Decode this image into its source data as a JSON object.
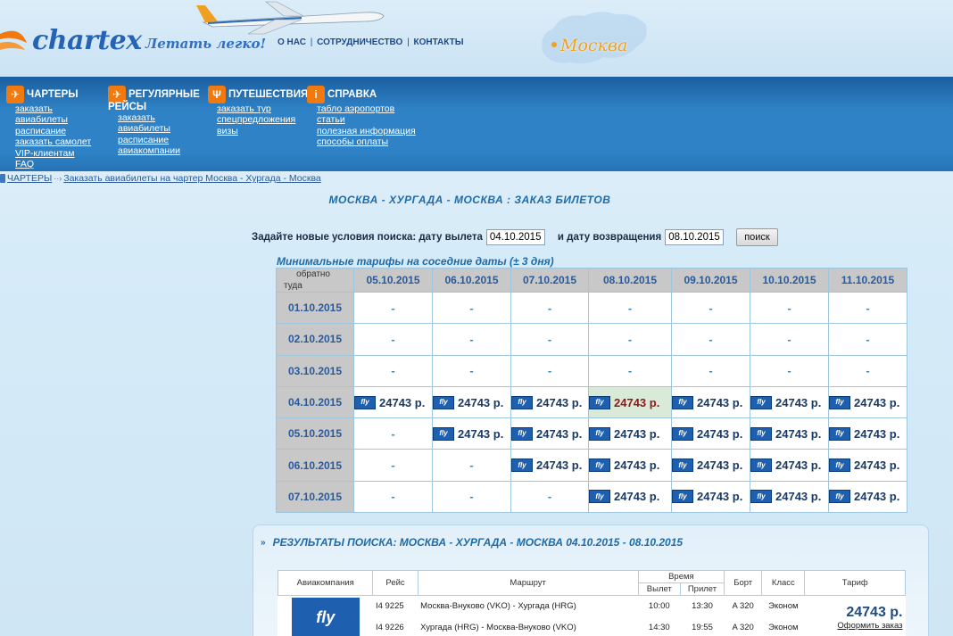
{
  "header": {
    "logo_text": "chartex",
    "slogan": "Летать легко!",
    "top_links": [
      "О НАС",
      "СОТРУДНИЧЕСТВО",
      "КОНТАКТЫ"
    ],
    "city": "Москва"
  },
  "menu": [
    {
      "title": "ЧАРТЕРЫ",
      "icon": "plane-icon",
      "items": [
        "заказать",
        "авиабилеты",
        "расписание",
        "заказать самолет",
        "VIP-клиентам",
        "FAQ"
      ]
    },
    {
      "title": "РЕГУЛЯРНЫЕ",
      "subtitle": "РЕЙСЫ",
      "icon": "plane-icon",
      "items": [
        "заказать",
        "авиабилеты",
        "расписание",
        "авиакомпании"
      ]
    },
    {
      "title": "ПУТЕШЕСТВИЯ",
      "icon": "palm-icon",
      "items": [
        "заказать тур",
        "спецпредложения",
        "визы"
      ]
    },
    {
      "title": "СПРАВКА",
      "icon": "info-icon",
      "items": [
        "табло аэропортов",
        "статьи",
        "полезная информация",
        "способы оплаты"
      ]
    }
  ],
  "breadcrumb": {
    "root": "ЧАРТЕРЫ",
    "current": "Заказать авиабилеты на чартер Москва - Хургада - Москва"
  },
  "page_title": "МОСКВА - ХУРГАДА - МОСКВА : ЗАКАЗ БИЛЕТОВ",
  "search": {
    "label_departure": "Задайте новые условия поиска: дату вылета",
    "departure_value": "04.10.2015",
    "label_return": "и дату возвращения",
    "return_value": "08.10.2015",
    "button": "поиск"
  },
  "matrix": {
    "caption": "Минимальные тарифы на соседние даты (± 3 дня)",
    "corner_back": "обратно",
    "corner_there": "туда",
    "return_dates": [
      "05.10.2015",
      "06.10.2015",
      "07.10.2015",
      "08.10.2015",
      "09.10.2015",
      "10.10.2015",
      "11.10.2015"
    ],
    "departure_dates": [
      "01.10.2015",
      "02.10.2015",
      "03.10.2015",
      "04.10.2015",
      "05.10.2015",
      "06.10.2015",
      "07.10.2015"
    ],
    "cells": [
      [
        "-",
        "-",
        "-",
        "-",
        "-",
        "-",
        "-"
      ],
      [
        "-",
        "-",
        "-",
        "-",
        "-",
        "-",
        "-"
      ],
      [
        "-",
        "-",
        "-",
        "-",
        "-",
        "-",
        "-"
      ],
      [
        "24743 р.",
        "24743 р.",
        "24743 р.",
        "24743 р.",
        "24743 р.",
        "24743 р.",
        "24743 р."
      ],
      [
        "-",
        "24743 р.",
        "24743 р.",
        "24743 р.",
        "24743 р.",
        "24743 р.",
        "24743 р."
      ],
      [
        "-",
        "-",
        "24743 р.",
        "24743 р.",
        "24743 р.",
        "24743 р.",
        "24743 р."
      ],
      [
        "-",
        "-",
        "-",
        "24743 р.",
        "24743 р.",
        "24743 р.",
        "24743 р."
      ]
    ],
    "selected": {
      "row": 3,
      "col": 3
    },
    "airline_badge": "fly"
  },
  "results": {
    "title": "РЕЗУЛЬТАТЫ ПОИСКА: МОСКВА - ХУРГАДА - МОСКВА 04.10.2015 - 08.10.2015",
    "headers": {
      "airline": "Авиакомпания",
      "flight": "Рейс",
      "route": "Маршрут",
      "time": "Время",
      "departure": "Вылет",
      "arrival": "Прилет",
      "aircraft": "Борт",
      "class": "Класс",
      "fare": "Тариф"
    },
    "logo_text": "fly",
    "rows": [
      {
        "flight": "I4 9225",
        "route": "Москва-Внуково (VKO) - Хургада (HRG)",
        "departure": "10:00",
        "arrival": "13:30",
        "aircraft": "A 320",
        "class": "Эконом"
      },
      {
        "flight": "I4 9226",
        "route": "Хургада (HRG) - Москва-Внуково (VKO)",
        "departure": "14:30",
        "arrival": "19:55",
        "aircraft": "A 320",
        "class": "Эконом"
      }
    ],
    "price": "24743 р.",
    "order_link": "Оформить заказ"
  }
}
